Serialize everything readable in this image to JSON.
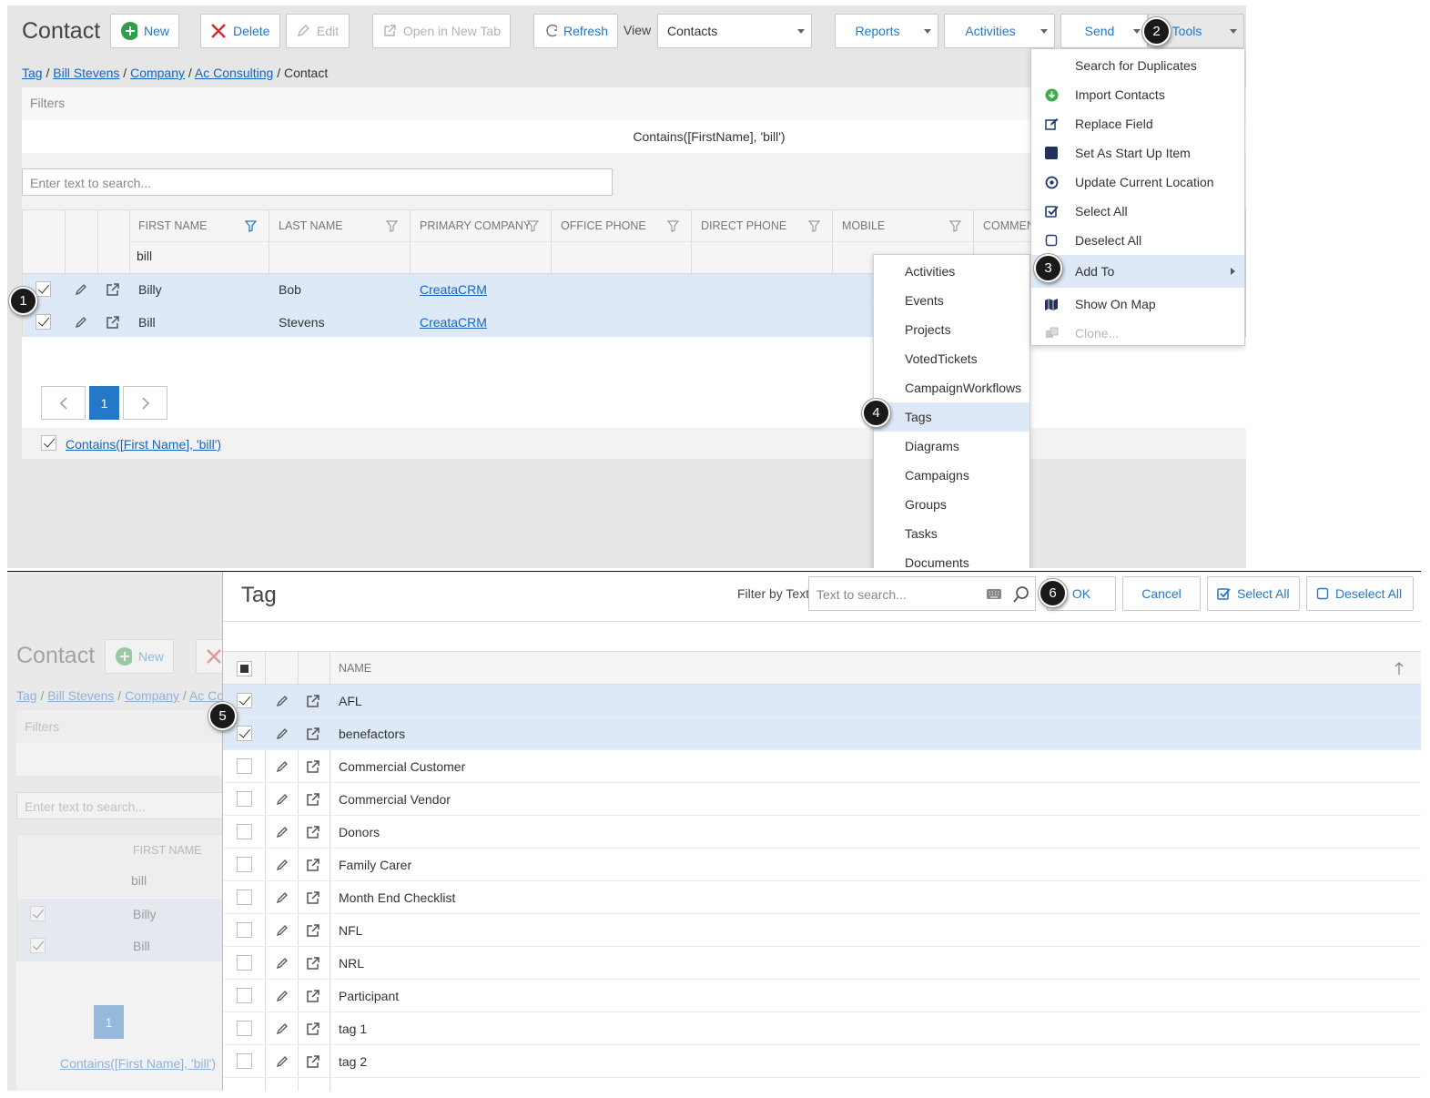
{
  "top": {
    "title": "Contact",
    "toolbar": {
      "new": "New",
      "delete": "Delete",
      "edit": "Edit",
      "open_new_tab": "Open in New Tab",
      "refresh": "Refresh",
      "view_label": "View",
      "view_value": "Contacts",
      "reports": "Reports",
      "activities": "Activities",
      "send": "Send",
      "tools": "Tools"
    },
    "breadcrumb": {
      "b1": "Tag",
      "b2": "Bill Stevens",
      "b3": "Company",
      "b4": "Ac Consulting",
      "current": "Contact",
      "sep": "/"
    },
    "filters_label": "Filters",
    "filter_expr": "Contains([FirstName], 'bill')",
    "search_placeholder": "Enter text to search...",
    "columns": [
      "FIRST NAME",
      "LAST NAME",
      "PRIMARY COMPANY",
      "OFFICE PHONE",
      "DIRECT PHONE",
      "MOBILE",
      "COMMEN"
    ],
    "filter_row_firstname": "bill",
    "rows": [
      {
        "first": "Billy",
        "last": "Bob",
        "company": "CreataCRM"
      },
      {
        "first": "Bill",
        "last": "Stevens",
        "company": "CreataCRM"
      }
    ],
    "pager": {
      "page": "1"
    },
    "active_filter": "Contains([First Name], 'bill')",
    "tools_menu": [
      "Search for Duplicates",
      "Import Contacts",
      "Replace Field",
      "Set As Start Up Item",
      "Update Current Location",
      "Select All",
      "Deselect All",
      "Add To",
      "Show On Map",
      "Clone..."
    ],
    "add_to_menu": [
      "Activities",
      "Events",
      "Projects",
      "VotedTickets",
      "CampaignWorkflows",
      "Tags",
      "Diagrams",
      "Campaigns",
      "Groups",
      "Tasks",
      "Documents"
    ],
    "badges": {
      "b1": "1",
      "b2": "2",
      "b3": "3",
      "b4": "4"
    }
  },
  "bottom": {
    "bg": {
      "title": "Contact",
      "new": "New",
      "breadcrumb": {
        "b1": "Tag",
        "b2": "Bill Stevens",
        "b3": "Company",
        "b4": "Ac Co"
      },
      "filters_label": "Filters",
      "search_placeholder": "Enter text to search...",
      "col_first": "FIRST NAME",
      "filter_val": "bill",
      "row1": "Billy",
      "row2": "Bill",
      "page": "1",
      "active_filter": "Contains([First Name], 'bill')"
    },
    "dialog": {
      "title": "Tag",
      "filter_by_text": "Filter by Text",
      "filter_placeholder": "Text to search...",
      "ok": "OK",
      "cancel": "Cancel",
      "select_all": "Select All",
      "deselect_all": "Deselect All",
      "col_name": "NAME",
      "rows": [
        "AFL",
        "benefactors",
        "Commercial Customer",
        "Commercial Vendor",
        "Donors",
        "Family Carer",
        "Month End Checklist",
        "NFL",
        "NRL",
        "Participant",
        "tag 1",
        "tag 2"
      ]
    },
    "badges": {
      "b5": "5",
      "b6": "6"
    }
  },
  "colors": {
    "accent": "#2577c7",
    "selected_row": "#dde9f7",
    "badge": "#1a1a1a",
    "new_icon": "#2e9e4a",
    "delete_icon": "#d32f2f"
  }
}
